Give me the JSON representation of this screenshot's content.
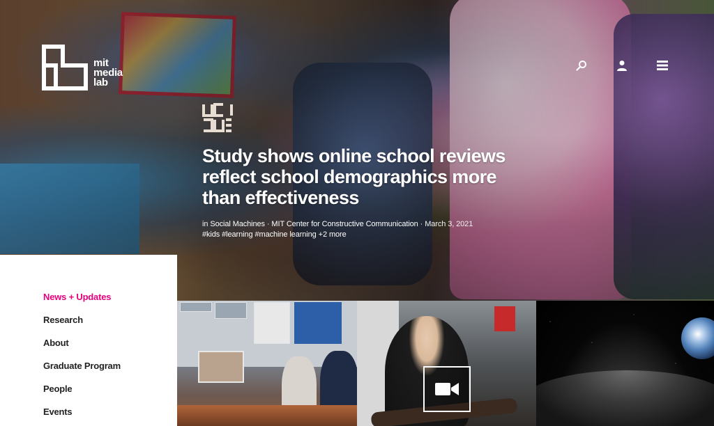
{
  "brand": {
    "name_line1": "mit",
    "name_line2": "media",
    "name_line3": "lab"
  },
  "header": {
    "icons": [
      "search-icon",
      "user-icon",
      "menu-icon"
    ]
  },
  "feature": {
    "headline": "Study shows online school reviews reflect school demographics more than effectiveness",
    "meta_prefix": "in ",
    "meta_group": "Social Machines",
    "meta_sep1": " · ",
    "meta_center": "MIT Center for Constructive Communication",
    "meta_sep2": " · ",
    "meta_date": "March 3, 2021",
    "tags": [
      "#kids",
      "#learning",
      "#machine learning",
      "+2 more"
    ]
  },
  "nav": {
    "items": [
      {
        "label": "News + Updates",
        "active": true
      },
      {
        "label": "Research",
        "active": false
      },
      {
        "label": "About",
        "active": false
      },
      {
        "label": "Graduate Program",
        "active": false
      },
      {
        "label": "People",
        "active": false
      },
      {
        "label": "Events",
        "active": false
      }
    ]
  },
  "tiles": [
    {
      "kind": "image"
    },
    {
      "kind": "video",
      "icon": "video-camera-icon"
    },
    {
      "kind": "image"
    }
  ],
  "colors": {
    "accent": "#e6007e",
    "nav_text": "#222222",
    "panel_bg": "#ffffff"
  }
}
